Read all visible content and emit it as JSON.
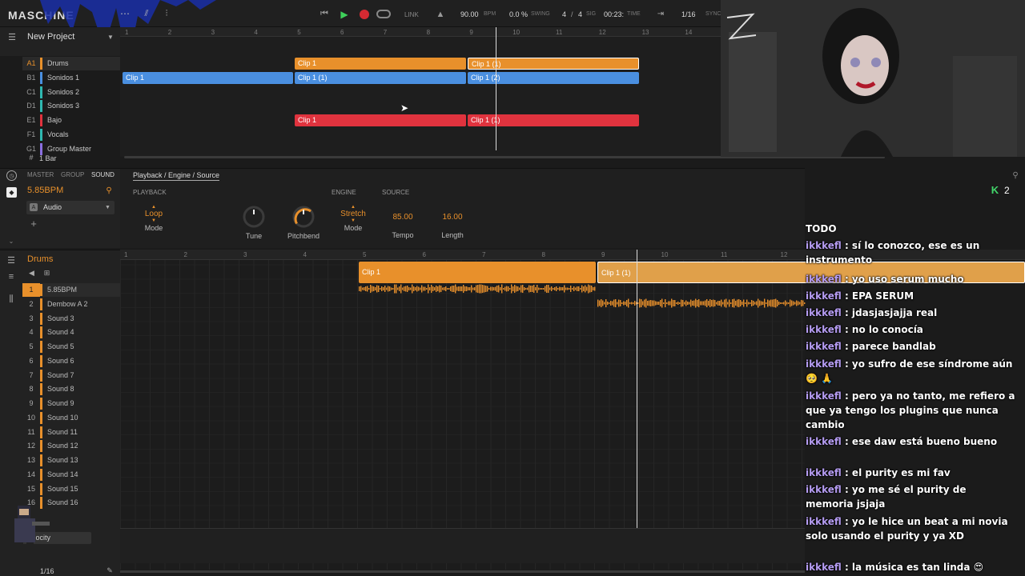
{
  "colors": {
    "orange": "#e8902b",
    "blue": "#4a8fe0",
    "red": "#e0333e",
    "teal": "#2fb8b0",
    "purple": "#8b6fe0",
    "chat_user": "#b59cf2",
    "accent_green": "#42d66a"
  },
  "app": {
    "logo": "MASCHINE",
    "project": "New Project"
  },
  "transport": {
    "link": "LINK",
    "tempo": "90.00",
    "tempo_unit": "BPM",
    "swing": "0.0 %",
    "swing_label": "SWING",
    "sig_num": "4",
    "sig_sep": "/",
    "sig_den": "4",
    "sig_label": "SIG",
    "time": "00:23:",
    "time_label": "TIME",
    "grid": "1/16",
    "sync": "SYNC"
  },
  "arranger": {
    "ruler": [
      "1",
      "2",
      "3",
      "4",
      "5",
      "6",
      "7",
      "8",
      "9",
      "10",
      "11",
      "12",
      "13",
      "14"
    ],
    "tracks": [
      {
        "id": "A1",
        "name": "Drums",
        "color": "#e8902b"
      },
      {
        "id": "B1",
        "name": "Sonidos 1",
        "color": "#4a8fe0"
      },
      {
        "id": "C1",
        "name": "Sonidos 2",
        "color": "#2fb8b0"
      },
      {
        "id": "D1",
        "name": "Sonidos 3",
        "color": "#2fb8b0"
      },
      {
        "id": "E1",
        "name": "Bajo",
        "color": "#e0333e"
      },
      {
        "id": "F1",
        "name": "Vocals",
        "color": "#2fb8b0"
      },
      {
        "id": "G1",
        "name": "Group Master",
        "color": "#8b6fe0"
      }
    ],
    "clips": {
      "a1_1": "Clip 1",
      "a1_2": "Clip 1 (1)",
      "b1_1": "Clip 1",
      "b1_2": "Clip 1 (1)",
      "b1_3": "Clip 1 (2)",
      "e1_1": "Clip 1",
      "e1_2": "Clip 1 (1)"
    },
    "zoom": "1 Bar"
  },
  "inspector": {
    "tabs": [
      "MASTER",
      "GROUP",
      "SOUND"
    ],
    "bpm": "5.85BPM",
    "plugin": "Audio",
    "breadcrumb": "Playback / Engine / Source",
    "sections": {
      "playback": "PLAYBACK",
      "engine": "ENGINE",
      "source": "SOURCE"
    },
    "params": [
      {
        "value": "Loop",
        "label": "Mode"
      },
      {
        "value": "",
        "label": "Tune"
      },
      {
        "value": "",
        "label": "Pitchbend"
      },
      {
        "value": "Stretch",
        "label": "Mode"
      },
      {
        "value": "85.00",
        "label": "Tempo"
      },
      {
        "value": "16.00",
        "label": "Length"
      }
    ],
    "k_count": "2"
  },
  "pattern": {
    "group": "Drums",
    "ruler": [
      "1",
      "2",
      "3",
      "4",
      "5",
      "6",
      "7",
      "8",
      "9",
      "10",
      "11",
      "12"
    ],
    "sounds": [
      "5.85BPM",
      "Dembow A 2",
      "Sound 3",
      "Sound 4",
      "Sound 5",
      "Sound 6",
      "Sound 7",
      "Sound 8",
      "Sound 9",
      "Sound 10",
      "Sound 11",
      "Sound 12",
      "Sound 13",
      "Sound 14",
      "Sound 15",
      "Sound 16"
    ],
    "clips": {
      "c1": "Clip 1",
      "c2": "Clip 1 (1)"
    },
    "velocity": "Velocity",
    "grid": "1/16"
  },
  "chat": {
    "title": "TODO",
    "messages": [
      {
        "user": "ikkkefl",
        "text": ": sí lo conozco, ese es un instrumento"
      },
      {
        "user": "ikkkefl",
        "text": ": yo uso serum mucho"
      },
      {
        "user": "ikkkefl",
        "text": ": EPA SERUM"
      },
      {
        "user": "ikkkefl",
        "text": ": jdasjasjajja real"
      },
      {
        "user": "ikkkefl",
        "text": ": no lo conocía"
      },
      {
        "user": "ikkkefl",
        "text": ": parece bandlab"
      },
      {
        "user": "ikkkefl",
        "text": ": yo sufro de ese síndrome aún 🥺 🙏"
      },
      {
        "user": "ikkkefl",
        "text": ": pero ya no tanto, me refiero a que ya tengo los plugins que nunca cambio"
      },
      {
        "user": "ikkkefl",
        "text": ": ese daw está bueno bueno"
      },
      {
        "user": "ikkkefl",
        "text": ": el purity es mi fav"
      },
      {
        "user": "ikkkefl",
        "text": ": yo me sé el purity de memoria jsjaja"
      },
      {
        "user": "ikkkefl",
        "text": ": yo le hice un beat a mi novia solo usando el purity y ya XD"
      },
      {
        "user": "ikkkefl",
        "text": ": la música es tan linda 😍"
      }
    ]
  }
}
